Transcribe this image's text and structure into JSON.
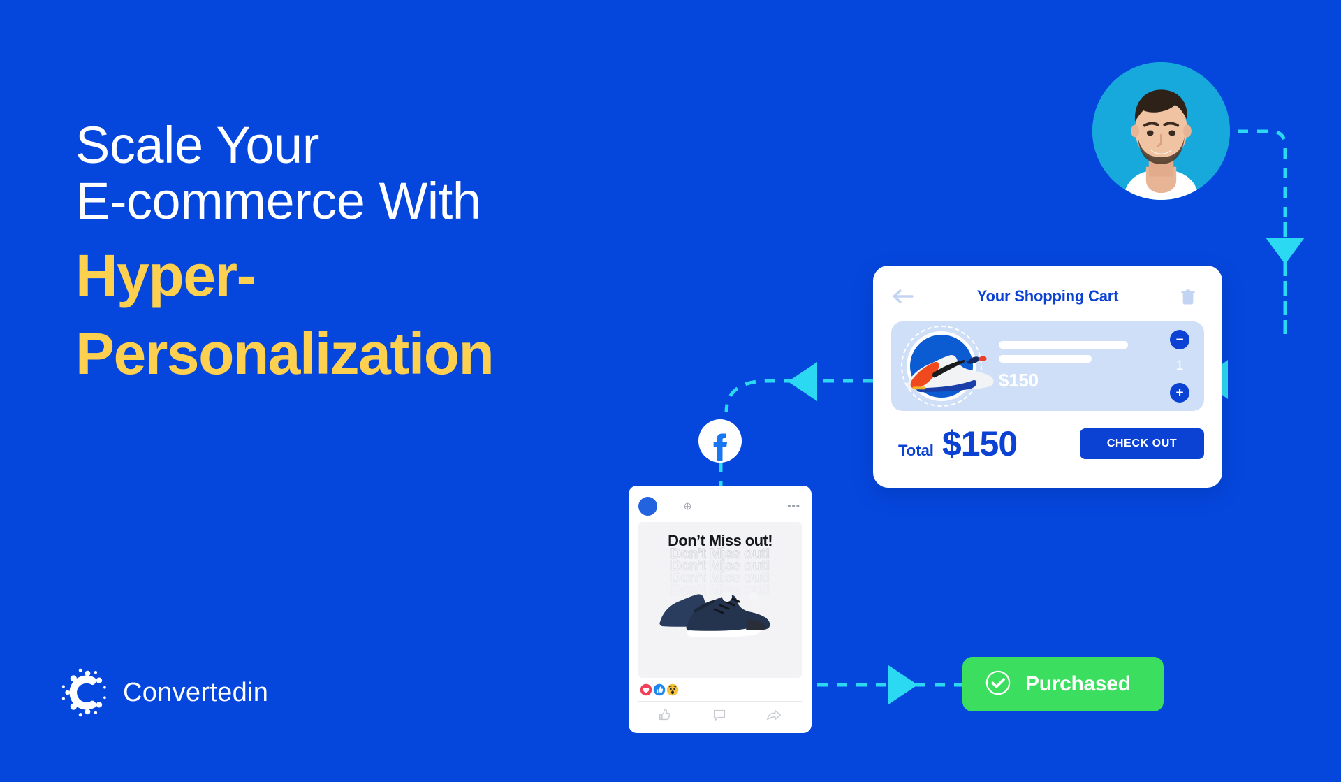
{
  "brand": {
    "background_color": "#0546DD",
    "accent_yellow": "#FDD050",
    "accent_cyan": "#2BD9F2",
    "accent_green": "#3BDE5E",
    "primary_blue": "#0B42D4",
    "logo_name": "Convertedin"
  },
  "headline": {
    "line1": "Scale Your",
    "line2": "E-commerce With",
    "line3": "Hyper-",
    "line4": "Personalization"
  },
  "avatar": {
    "alt": "smiling-man-portrait"
  },
  "cart": {
    "title": "Your Shopping Cart",
    "back_icon": "back-arrow-icon",
    "delete_icon": "trash-icon",
    "item": {
      "image": "running-shoe",
      "price": "$150",
      "quantity": "1",
      "decrease_label": "−",
      "increase_label": "+"
    },
    "total_label": "Total",
    "total_value": "$150",
    "checkout_label": "CHECK OUT"
  },
  "social": {
    "platform_icon": "facebook-icon",
    "post": {
      "menu": "•••",
      "headline": "Don’t Miss out!",
      "echo_lines": [
        "Don’t Miss out!",
        "Don’t Miss out!",
        "Don’t Miss out!",
        "Don’t Miss out!"
      ],
      "product_image": "navy-sneakers",
      "reactions": [
        "love-reaction",
        "like-reaction",
        "wow-reaction"
      ],
      "actions": [
        "like-icon",
        "comment-icon",
        "share-icon"
      ]
    }
  },
  "status": {
    "purchased_label": "Purchased",
    "purchased_icon": "check-circle-icon"
  }
}
